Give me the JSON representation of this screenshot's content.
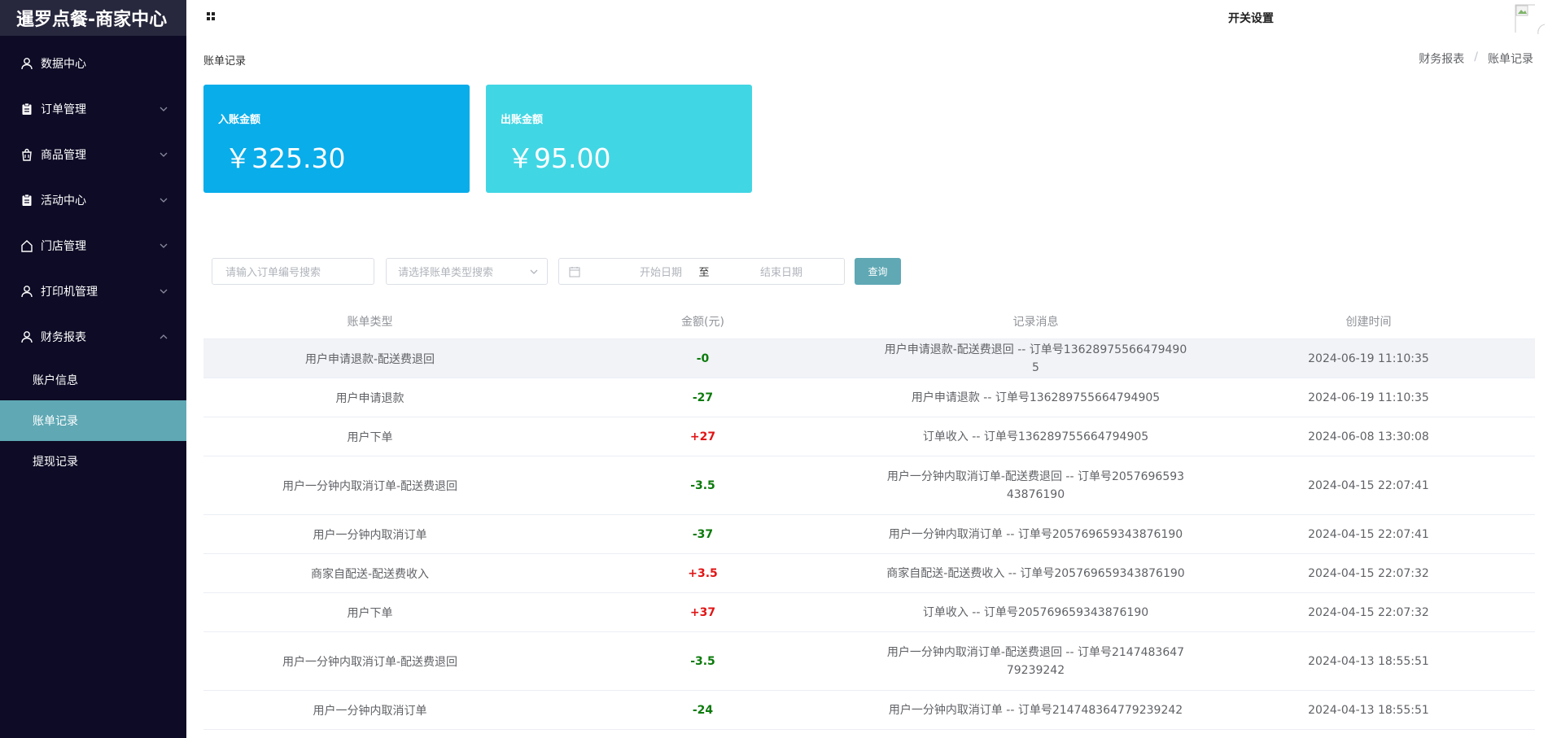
{
  "brand": "暹罗点餐-商家中心",
  "header": {
    "title": "开关设置"
  },
  "menu": [
    {
      "label": "数据中心",
      "icon": "user-icon"
    },
    {
      "label": "订单管理",
      "icon": "clipboard-icon"
    },
    {
      "label": "商品管理",
      "icon": "bag-icon"
    },
    {
      "label": "活动中心",
      "icon": "clipboard-icon"
    },
    {
      "label": "门店管理",
      "icon": "home-icon"
    },
    {
      "label": "打印机管理",
      "icon": "user-icon"
    },
    {
      "label": "财务报表",
      "icon": "user-icon"
    }
  ],
  "submenu": [
    {
      "label": "账户信息"
    },
    {
      "label": "账单记录"
    },
    {
      "label": "提现记录"
    }
  ],
  "page": {
    "title": "账单记录"
  },
  "breadcrumb": {
    "parent": "财务报表",
    "sep": "/",
    "current": "账单记录"
  },
  "cards": {
    "income": {
      "label": "入账金额",
      "value": "￥325.30"
    },
    "outgo": {
      "label": "出账金额",
      "value": "￥95.00"
    }
  },
  "filters": {
    "order_placeholder": "请输入订单编号搜索",
    "type_placeholder": "请选择账单类型搜索",
    "start_placeholder": "开始日期",
    "range_sep": "至",
    "end_placeholder": "结束日期",
    "query_label": "查询"
  },
  "table": {
    "headers": [
      "账单类型",
      "金额(元)",
      "记录消息",
      "创建时间"
    ],
    "rows": [
      {
        "type": "用户申请退款-配送费退回",
        "amount": "-0",
        "message": "用户申请退款-配送费退回 -- 订单号136289755664794905",
        "time": "2024-06-19 11:10:35"
      },
      {
        "type": "用户申请退款",
        "amount": "-27",
        "message": "用户申请退款 -- 订单号136289755664794905",
        "time": "2024-06-19 11:10:35"
      },
      {
        "type": "用户下单",
        "amount": "+27",
        "message": "订单收入 -- 订单号136289755664794905",
        "time": "2024-06-08 13:30:08"
      },
      {
        "type": "用户一分钟内取消订单-配送费退回",
        "amount": "-3.5",
        "message": "用户一分钟内取消订单-配送费退回 -- 订单号205769659343876190",
        "time": "2024-04-15 22:07:41"
      },
      {
        "type": "用户一分钟内取消订单",
        "amount": "-37",
        "message": "用户一分钟内取消订单 -- 订单号205769659343876190",
        "time": "2024-04-15 22:07:41"
      },
      {
        "type": "商家自配送-配送费收入",
        "amount": "+3.5",
        "message": "商家自配送-配送费收入 -- 订单号205769659343876190",
        "time": "2024-04-15 22:07:32"
      },
      {
        "type": "用户下单",
        "amount": "+37",
        "message": "订单收入 -- 订单号205769659343876190",
        "time": "2024-04-15 22:07:32"
      },
      {
        "type": "用户一分钟内取消订单-配送费退回",
        "amount": "-3.5",
        "message": "用户一分钟内取消订单-配送费退回 -- 订单号214748364779239242",
        "time": "2024-04-13 18:55:51"
      },
      {
        "type": "用户一分钟内取消订单",
        "amount": "-24",
        "message": "用户一分钟内取消订单 -- 订单号214748364779239242",
        "time": "2024-04-13 18:55:51"
      }
    ]
  },
  "colors": {
    "sidebar_bg": "#0d0b25",
    "active": "#5fa8b4",
    "card_in": "#09adea",
    "card_out": "#41d6e4",
    "negative": "#0b7a0b",
    "positive": "#e01515"
  }
}
